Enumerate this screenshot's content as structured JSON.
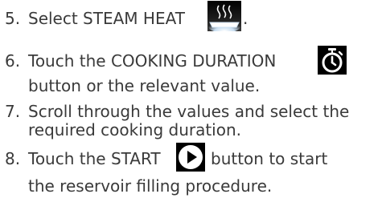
{
  "steps": [
    {
      "number": "5.",
      "line1": "Select STEAM HEAT",
      "line1_suffix": "."
    },
    {
      "number": "6.",
      "line1": "Touch the COOKING DURATION",
      "line2": "button or the relevant value."
    },
    {
      "number": "7.",
      "line1": "Scroll through the values and select the",
      "line2": "required cooking duration."
    },
    {
      "number": "8.",
      "line1_a": "Touch the START",
      "line1_b": "button to start",
      "line2": "the reservoir filling procedure."
    }
  ],
  "icons": {
    "steam_heat": "steam-heat-icon",
    "timer": "stopwatch-icon",
    "start": "play-icon"
  },
  "colors": {
    "text": "#3a3a3a",
    "icon_bg": "#000000",
    "icon_fg": "#ffffff",
    "steam_glow": "#c9dff2"
  }
}
